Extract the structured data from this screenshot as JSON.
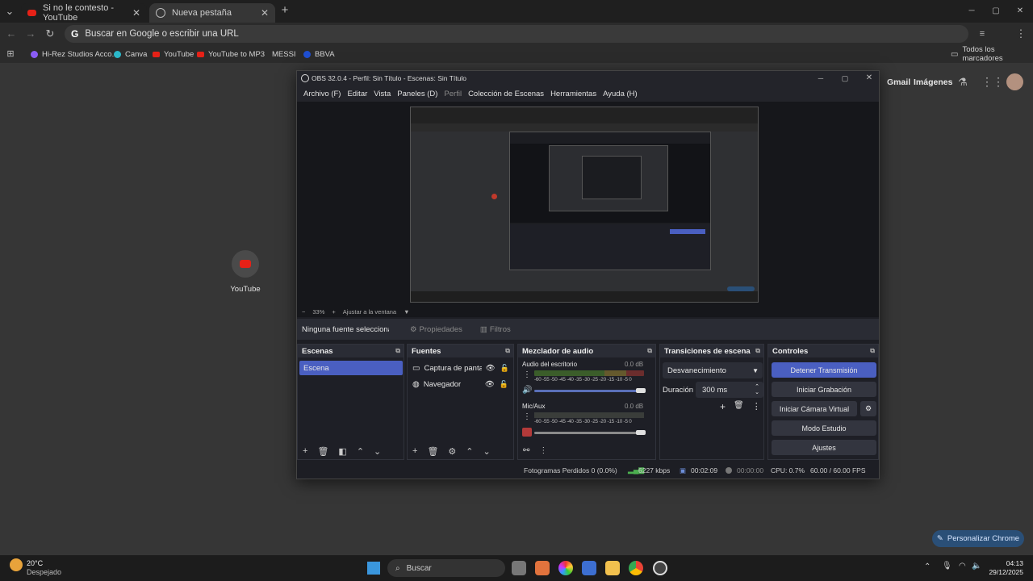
{
  "browser": {
    "tabs": [
      {
        "label": "Si no le contesto - YouTube",
        "close": "✕"
      },
      {
        "label": "Nueva pestaña",
        "close": "✕"
      }
    ],
    "new_tab": "+",
    "address_placeholder": "Buscar en Google o escribir una URL",
    "bookmarks": [
      "Hi-Rez Studios Acco...",
      "Canva",
      "YouTube",
      "YouTube to MP3",
      "MESSI",
      "BBVA"
    ],
    "all_bookmarks": "Todos los marcadores",
    "window_controls": [
      "─",
      "▢",
      "✕"
    ]
  },
  "ntp": {
    "links": [
      "Gmail",
      "Imágenes"
    ],
    "shortcut_label": "YouTube",
    "customize": "Personalizar Chrome"
  },
  "obs": {
    "title": "OBS 32.0.4 - Perfil: Sin Título - Escenas: Sin Título",
    "menu": [
      "Archivo (F)",
      "Editar",
      "Vista",
      "Paneles (D)",
      "Perfil",
      "Colección de Escenas",
      "Herramientas",
      "Ayuda (H)"
    ],
    "zoom": {
      "minus": "−",
      "value": "33%",
      "plus": "+",
      "fit": "Ajustar a la ventana",
      "arrow": "▼"
    },
    "source_bar": {
      "none": "Ninguna fuente seleccionada",
      "properties": "Propiedades",
      "filters": "Filtros"
    },
    "scenes": {
      "title": "Escenas",
      "items": [
        "Escena"
      ]
    },
    "sources": {
      "title": "Fuentes",
      "items": [
        "Captura de pantalla",
        "Navegador"
      ]
    },
    "mixer": {
      "title": "Mezclador de audio",
      "channels": [
        {
          "name": "Audio del escritorio",
          "db": "0.0 dB"
        },
        {
          "name": "Mic/Aux",
          "db": "0.0 dB"
        }
      ],
      "scale": "-60 -55 -50 -45 -40 -35 -30 -25 -20 -15 -10 -5 0"
    },
    "transitions": {
      "title": "Transiciones de escena",
      "type": "Desvanecimiento",
      "duration_label": "Duración",
      "duration": "300 ms"
    },
    "controls": {
      "title": "Controles",
      "buttons": [
        "Detener Transmisión",
        "Iniciar Grabación",
        "Iniciar Cámara Virtual",
        "Modo Estudio",
        "Ajustes"
      ]
    },
    "status": {
      "dropped": "Fotogramas Perdidos 0 (0.0%)",
      "bitrate": "6227 kbps",
      "stream_time": "00:02:09",
      "rec_time": "00:00:00",
      "cpu": "CPU: 0.7%",
      "fps": "60.00 / 60.00 FPS"
    }
  },
  "taskbar": {
    "weather_temp": "20°C",
    "weather_desc": "Despejado",
    "search": "Buscar",
    "time": "04:13",
    "date": "29/12/2025"
  },
  "colors": {
    "accent": "#4a5fc1",
    "youtube": "#e62117"
  }
}
